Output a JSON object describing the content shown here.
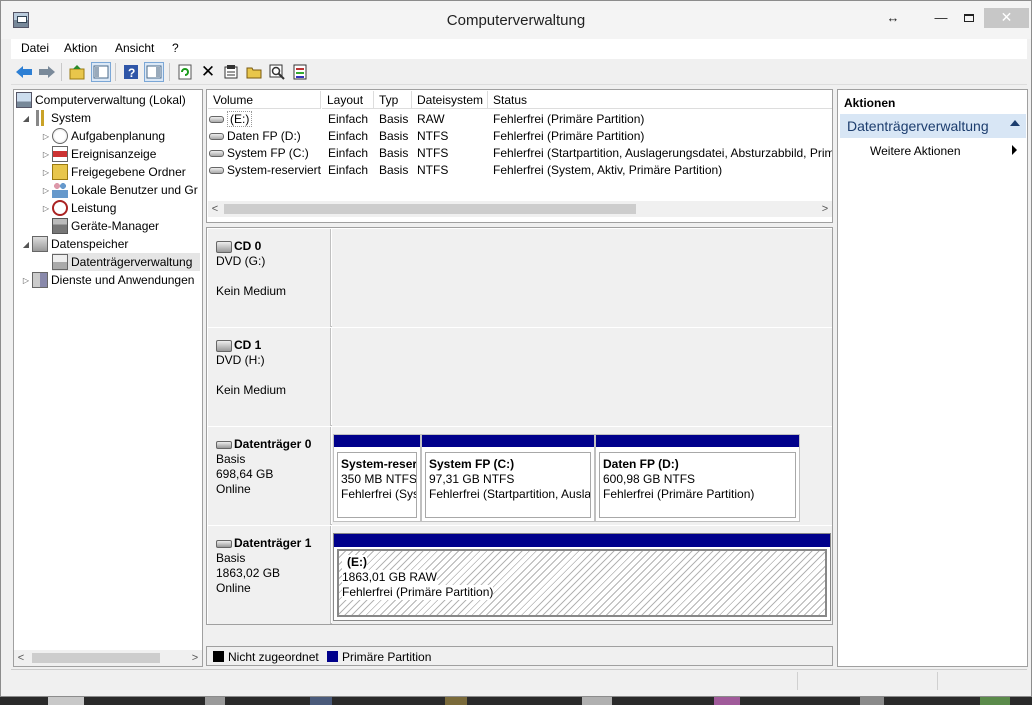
{
  "window": {
    "title": "Computerverwaltung",
    "resize_glyph": "↔",
    "min_glyph": "—",
    "close_glyph": "✕"
  },
  "menu": [
    "Datei",
    "Aktion",
    "Ansicht",
    "?"
  ],
  "toolbar": {
    "icons": [
      "back-icon",
      "forward-icon",
      "up-folder-icon",
      "show-hide-tree-icon",
      "help-icon",
      "show-hide-action-pane-icon",
      "refresh-icon",
      "delete-icon",
      "properties-icon",
      "open-icon",
      "search-icon",
      "export-icon"
    ]
  },
  "tree": {
    "root": "Computerverwaltung (Lokal)",
    "system": "System",
    "aufgabenplanung": "Aufgabenplanung",
    "ereignisanzeige": "Ereignisanzeige",
    "freigegebene_ordner": "Freigegebene Ordner",
    "lokale_benutzer": "Lokale Benutzer und Gr",
    "leistung": "Leistung",
    "geraete_manager": "Geräte-Manager",
    "datenspeicher": "Datenspeicher",
    "datentraegerverwaltung": "Datenträgerverwaltung",
    "dienste": "Dienste und Anwendungen"
  },
  "volumes": {
    "columns": [
      "Volume",
      "Layout",
      "Typ",
      "Dateisystem",
      "Status"
    ],
    "rows": [
      [
        "(E:)",
        "Einfach",
        "Basis",
        "RAW",
        "Fehlerfrei (Primäre Partition)"
      ],
      [
        "Daten FP (D:)",
        "Einfach",
        "Basis",
        "NTFS",
        "Fehlerfrei (Primäre Partition)"
      ],
      [
        "System FP (C:)",
        "Einfach",
        "Basis",
        "NTFS",
        "Fehlerfrei (Startpartition, Auslagerungsdatei, Absturzabbild, Prim"
      ],
      [
        "System-reserviert",
        "Einfach",
        "Basis",
        "NTFS",
        "Fehlerfrei (System, Aktiv, Primäre Partition)"
      ]
    ]
  },
  "disks": {
    "cd0": {
      "name": "CD 0",
      "type": "DVD (G:)",
      "state": "Kein Medium"
    },
    "cd1": {
      "name": "CD 1",
      "type": "DVD (H:)",
      "state": "Kein Medium"
    },
    "disk0": {
      "name": "Datenträger 0",
      "type": "Basis",
      "size": "698,64 GB",
      "status": "Online",
      "partitions": [
        {
          "name": "System-reser",
          "size": "350 MB NTFS",
          "status": "Fehlerfrei (Sys"
        },
        {
          "name": "System FP  (C:)",
          "size": "97,31 GB NTFS",
          "status": "Fehlerfrei (Startpartition, Ausla"
        },
        {
          "name": "Daten FP  (D:)",
          "size": "600,98 GB NTFS",
          "status": "Fehlerfrei (Primäre Partition)"
        }
      ]
    },
    "disk1": {
      "name": "Datenträger 1",
      "type": "Basis",
      "size": "1863,02 GB",
      "status": "Online",
      "partitions": [
        {
          "name": "(E:)",
          "size": "1863,01 GB RAW",
          "status": "Fehlerfrei (Primäre Partition)"
        }
      ]
    }
  },
  "legend": {
    "unallocated": "Nicht zugeordnet",
    "unallocated_color": "#000000",
    "primary": "Primäre Partition",
    "primary_color": "#00008b"
  },
  "actions": {
    "header": "Aktionen",
    "section": "Datenträgerverwaltung",
    "more": "Weitere Aktionen"
  }
}
